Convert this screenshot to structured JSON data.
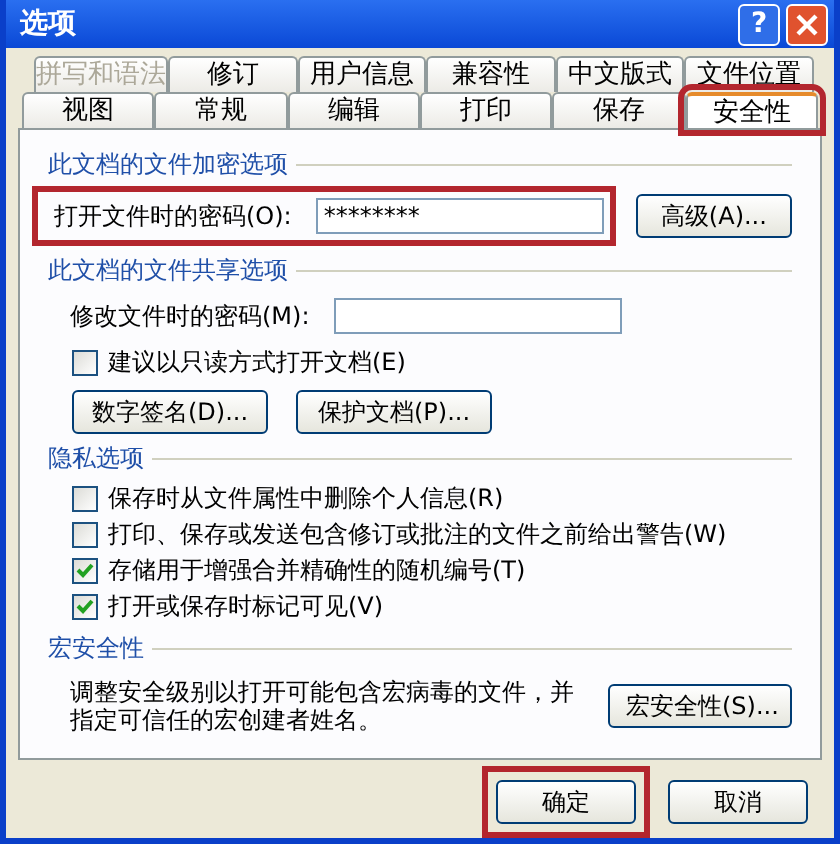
{
  "window": {
    "title": "选项",
    "help_button": "?"
  },
  "tab_rows": [
    [
      {
        "label": "拼写和语法",
        "selected": false,
        "disabled": true,
        "highlighted": false
      },
      {
        "label": "修订",
        "selected": false,
        "disabled": false,
        "highlighted": false
      },
      {
        "label": "用户信息",
        "selected": false,
        "disabled": false,
        "highlighted": false
      },
      {
        "label": "兼容性",
        "selected": false,
        "disabled": false,
        "highlighted": false
      },
      {
        "label": "中文版式",
        "selected": false,
        "disabled": false,
        "highlighted": false
      },
      {
        "label": "文件位置",
        "selected": false,
        "disabled": false,
        "highlighted": false
      }
    ],
    [
      {
        "label": "视图",
        "selected": false,
        "disabled": false,
        "highlighted": false
      },
      {
        "label": "常规",
        "selected": false,
        "disabled": false,
        "highlighted": false
      },
      {
        "label": "编辑",
        "selected": false,
        "disabled": false,
        "highlighted": false
      },
      {
        "label": "打印",
        "selected": false,
        "disabled": false,
        "highlighted": false
      },
      {
        "label": "保存",
        "selected": false,
        "disabled": false,
        "highlighted": false
      },
      {
        "label": "安全性",
        "selected": true,
        "disabled": false,
        "highlighted": true
      }
    ]
  ],
  "encryption": {
    "title": "此文档的文件加密选项",
    "password_label": "打开文件时的密码(O):",
    "password_value": "********",
    "highlighted": true,
    "advanced_button": "高级(A)..."
  },
  "sharing": {
    "title": "此文档的文件共享选项",
    "modify_label": "修改文件时的密码(M):",
    "readonly": {
      "label": "建议以只读方式打开文档(E)",
      "checked": false
    },
    "buttons": [
      "数字签名(D)...",
      "保护文档(P)..."
    ]
  },
  "privacy": {
    "title": "隐私选项",
    "options": [
      {
        "label": "保存时从文件属性中删除个人信息(R)",
        "checked": false
      },
      {
        "label": "打印、保存或发送包含修订或批注的文件之前给出警告(W)",
        "checked": false
      },
      {
        "label": "存储用于增强合并精确性的随机编号(T)",
        "checked": true
      },
      {
        "label": "打开或保存时标记可见(V)",
        "checked": true
      }
    ]
  },
  "macro": {
    "title": "宏安全性",
    "description": "调整安全级别以打开可能包含宏病毒的文件，并指定可信任的宏创建者姓名。",
    "button": "宏安全性(S)..."
  },
  "footer": [
    {
      "label": "确定",
      "highlighted": true
    },
    {
      "label": "取消",
      "highlighted": false
    }
  ]
}
